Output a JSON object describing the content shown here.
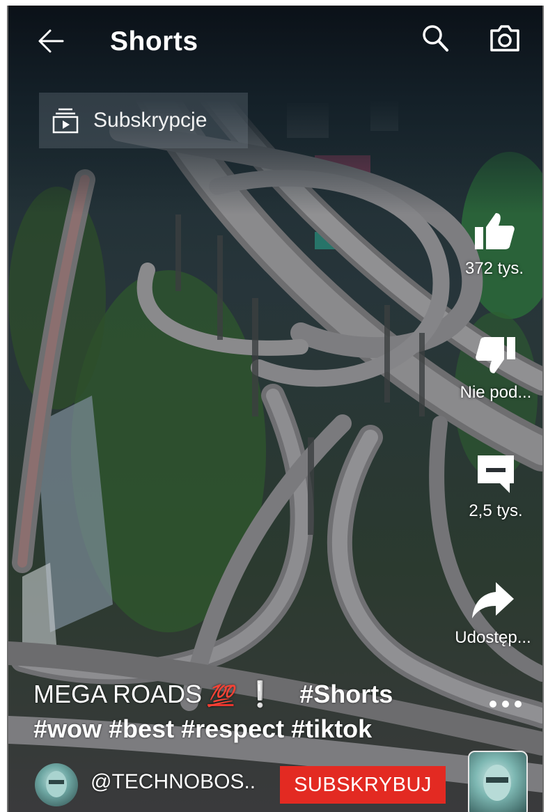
{
  "header": {
    "title": "Shorts",
    "back_icon": "arrow-left-icon",
    "search_icon": "search-icon",
    "camera_icon": "camera-icon"
  },
  "subscriptions_chip": {
    "label": "Subskrypcje",
    "icon": "subscriptions-icon"
  },
  "actions": {
    "like": {
      "label": "372 tys.",
      "icon": "thumbs-up-icon"
    },
    "dislike": {
      "label": "Nie pod...",
      "icon": "thumbs-down-icon"
    },
    "comments": {
      "label": "2,5 tys.",
      "icon": "comment-icon"
    },
    "share": {
      "label": "Udostęp...",
      "icon": "share-arrow-icon"
    },
    "more": {
      "icon": "more-dots-icon"
    }
  },
  "caption": {
    "title_part": "MEGA ROADS",
    "emoji": "💯",
    "exclamation": "❕",
    "tag_first": "#Shorts",
    "tags_line": "#wow #best #respect #tiktok"
  },
  "channel": {
    "handle": "@TECHNOBOS..",
    "subscribe_label": "SUBSKRYBUJ"
  },
  "colors": {
    "subscribe": "#e32a22",
    "text": "#ffffff",
    "overlay_chip": "rgba(130,140,150,0.28)"
  }
}
